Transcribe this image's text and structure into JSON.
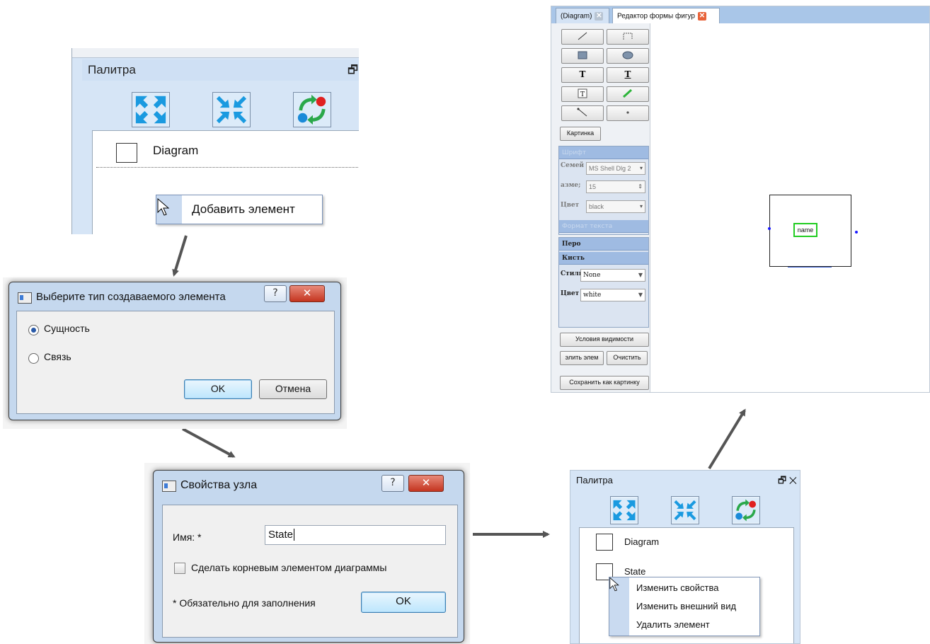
{
  "palette1": {
    "title": "Палитра",
    "float_glyph": "🗗",
    "icons": [
      "expand-icon",
      "collapse-icon",
      "refresh-icon"
    ],
    "item": "Diagram",
    "context_menu_item": "Добавить элемент"
  },
  "type_dialog": {
    "title": "Выберите тип создаваемого элемента",
    "help": "?",
    "close": "✕",
    "option_entity": "Сущность",
    "option_link": "Связь",
    "ok": "OK",
    "cancel": "Отмена"
  },
  "node_dialog": {
    "title": "Свойства узла",
    "help": "?",
    "close": "✕",
    "name_label": "Имя: *",
    "name_value": "State",
    "root_checkbox": "Сделать корневым элементом диаграммы",
    "required_note": "* Обязательно для заполнения",
    "ok": "OK"
  },
  "editor": {
    "tab1": "(Diagram)",
    "tab2": "Редактор формы фигур",
    "tab_close": "✕",
    "tool_text": "T",
    "tool_text2": "T",
    "tool_image": "Картинка",
    "font_header": "Шрифт",
    "family_label": "Семей",
    "family_value": "MS Shell Dlg 2",
    "size_label": "азме;",
    "size_value": "15",
    "color_label": "Цвет",
    "color_value": "black",
    "text_format_header": "Формат текста",
    "pen_header": "Перо",
    "brush_header": "Кисть",
    "style_label": "Стиль",
    "style_value": "None",
    "brush_color_label": "Цвет",
    "brush_color_value": "white",
    "visibility_button": "Условия видимости",
    "delete_button": "элить элем",
    "clear_button": "Очистить",
    "save_button": "Сохранить как картинку",
    "shape_label": "name"
  },
  "palette2": {
    "title": "Палитра",
    "controls": "🗗 ✕",
    "items": [
      "Diagram",
      "State"
    ],
    "menu": [
      "Изменить свойства",
      "Изменить внешний вид",
      "Удалить элемент"
    ]
  },
  "colors": {
    "panel_blue": "#d6e5f6",
    "arrow": "#555555",
    "shape_label_border": "#22cc22",
    "port_dot": "#1a1aff"
  }
}
